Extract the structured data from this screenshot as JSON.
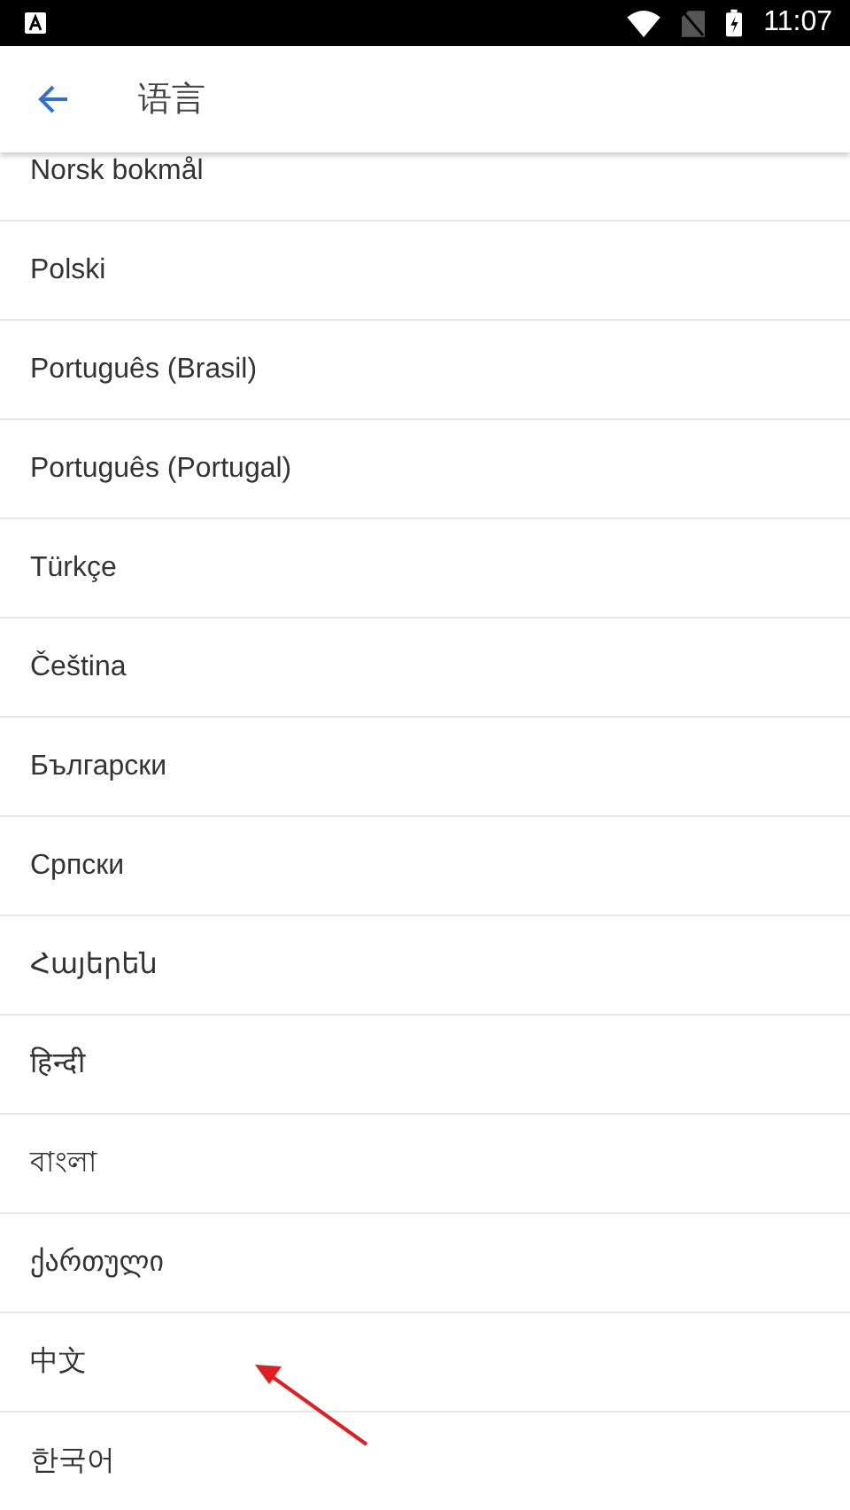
{
  "status_bar": {
    "time": "11:07"
  },
  "app_bar": {
    "title": "语言"
  },
  "languages": [
    {
      "label": "Norsk bokmål"
    },
    {
      "label": "Polski"
    },
    {
      "label": "Português (Brasil)"
    },
    {
      "label": "Português (Portugal)"
    },
    {
      "label": "Türkçe"
    },
    {
      "label": "Čeština"
    },
    {
      "label": "Български"
    },
    {
      "label": "Српски"
    },
    {
      "label": "Հայերեն"
    },
    {
      "label": "हिन्दी"
    },
    {
      "label": "বাংলা"
    },
    {
      "label": "ქართული"
    },
    {
      "label": "中文"
    },
    {
      "label": "한국어"
    }
  ]
}
